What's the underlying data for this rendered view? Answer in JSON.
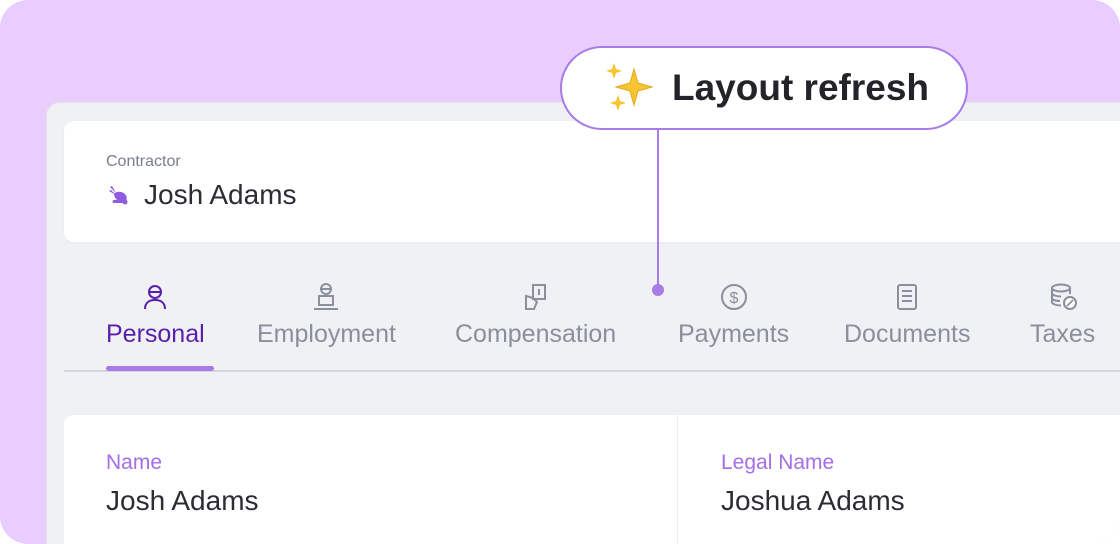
{
  "header": {
    "role_label": "Contractor",
    "name": "Josh Adams",
    "brand_icon": "rabbit-logo-icon"
  },
  "tabs": [
    {
      "label": "Personal",
      "icon": "person-icon",
      "active": true
    },
    {
      "label": "Employment",
      "icon": "person-laptop-icon",
      "active": false
    },
    {
      "label": "Compensation",
      "icon": "hand-cash-icon",
      "active": false
    },
    {
      "label": "Payments",
      "icon": "dollar-circle-icon",
      "active": false
    },
    {
      "label": "Documents",
      "icon": "document-icon",
      "active": false
    },
    {
      "label": "Taxes",
      "icon": "coins-percent-icon",
      "active": false
    }
  ],
  "details": {
    "name_label": "Name",
    "name_value": "Josh Adams",
    "legal_name_label": "Legal Name",
    "legal_name_value": "Joshua Adams"
  },
  "callout": {
    "text": "Layout refresh",
    "icon": "sparkles-icon"
  },
  "colors": {
    "background": "#e9cdfd",
    "accent": "#a77be8",
    "active_tab": "#5a1fa8",
    "inactive_tab": "#8a8f9c",
    "text": "#2b2d33"
  }
}
